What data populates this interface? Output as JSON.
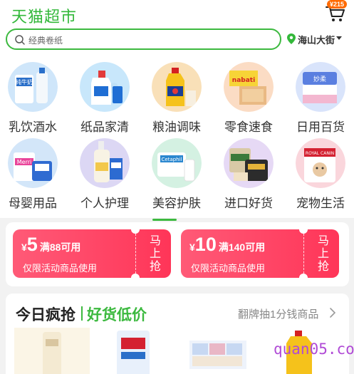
{
  "header": {
    "brand": "天猫超市",
    "cart_badge": "¥215"
  },
  "search": {
    "placeholder": "经典卷纸"
  },
  "location": {
    "text": "海山大街"
  },
  "categories": [
    {
      "label": "乳饮酒水",
      "icon": "milk-bottle-icon"
    },
    {
      "label": "纸品家清",
      "icon": "detergent-bottle-icon"
    },
    {
      "label": "粮油调味",
      "icon": "cooking-oil-icon"
    },
    {
      "label": "零食速食",
      "icon": "snack-pack-icon"
    },
    {
      "label": "日用百货",
      "icon": "tissue-box-icon"
    },
    {
      "label": "母婴用品",
      "icon": "diaper-pack-icon"
    },
    {
      "label": "个人护理",
      "icon": "lotion-bottle-icon"
    },
    {
      "label": "美容护肤",
      "icon": "skincare-tube-icon"
    },
    {
      "label": "进口好货",
      "icon": "import-snack-icon"
    },
    {
      "label": "宠物生活",
      "icon": "pet-food-icon"
    }
  ],
  "coupons": [
    {
      "yen": "¥",
      "amount": "5",
      "condition": "满88可用",
      "desc": "仅限活动商品使用",
      "cta": "马上抢"
    },
    {
      "yen": "¥",
      "amount": "10",
      "condition": "满140可用",
      "desc": "仅限活动商品使用",
      "cta": "马上抢"
    }
  ],
  "flash_sale": {
    "title": "今日疯抢",
    "subtitle": "好货低价",
    "more": "翻牌抽1分钱商品"
  },
  "watermark": "quan05.com",
  "colors": {
    "brand_green": "#33b83a",
    "coupon_red": "#ff3558",
    "badge_orange": "#ff6a00"
  }
}
